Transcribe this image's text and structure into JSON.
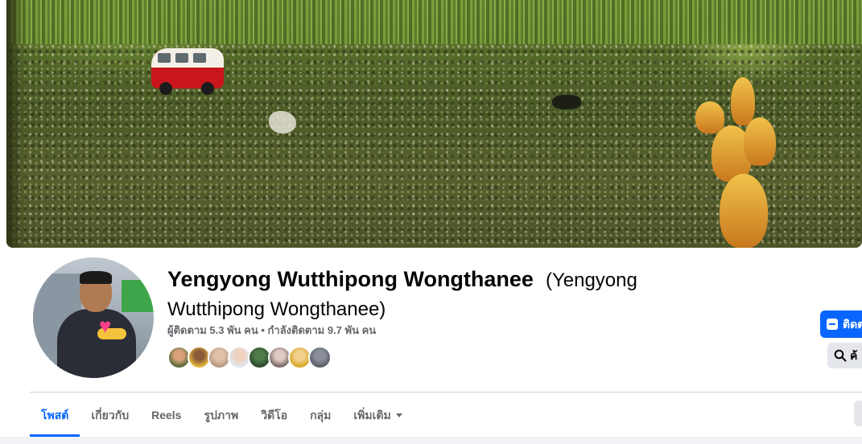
{
  "profile": {
    "name": "Yengyong Wutthipong Wongthanee",
    "alternate_name": "(Yengyong Wutthipong Wongthanee)",
    "stats": "ผู้ติดตาม 5.3 พัน คน • กำลังติดตาม 9.7 พัน คน",
    "friend_avatars": [
      "friend-1",
      "friend-2",
      "friend-3",
      "friend-4",
      "friend-5",
      "friend-6",
      "friend-7",
      "friend-8"
    ]
  },
  "actions": {
    "follow_label": "ติดต",
    "search_label": "ค้"
  },
  "tabs": [
    {
      "label": "โพสต์",
      "active": true
    },
    {
      "label": "เกี่ยวกับ",
      "active": false
    },
    {
      "label": "Reels",
      "active": false
    },
    {
      "label": "รูปภาพ",
      "active": false
    },
    {
      "label": "วิดีโอ",
      "active": false
    },
    {
      "label": "กลุ่ม",
      "active": false
    },
    {
      "label": "เพิ่มเติม",
      "active": false
    }
  ],
  "colors": {
    "accent": "#0866ff",
    "text_primary": "#050505",
    "text_secondary": "#65676b",
    "button_gray": "#e4e6eb"
  },
  "icons": {
    "follow": "follow-icon",
    "search": "search-icon",
    "more": "chevron-down-icon"
  }
}
